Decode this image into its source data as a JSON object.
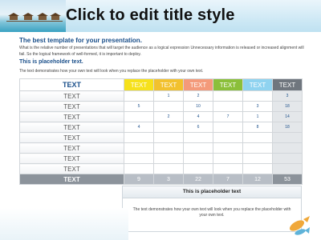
{
  "slide": {
    "title": "Click to edit title style",
    "subtitle": "The best template for your presentation.",
    "intro": "What is the relative number of presentations that will target the audience as a logical expression Unnecessary information is released or increased alignment will fail. So the logical framework of well-formed, it is important to deploy.",
    "placeholder_heading": "This is placeholder text.",
    "placeholder_body": "The text demonstrates how your own text will look when you replace the placeholder with your own text."
  },
  "table": {
    "header_label": "TEXT",
    "columns": [
      "TEXT",
      "TEXT",
      "TEXT",
      "TEXT",
      "TEXT",
      "TEXT"
    ],
    "column_colors": [
      "#f6e11c",
      "#f2c12e",
      "#f49a7a",
      "#8bbf3a",
      "#8fd3f0",
      "#6f767e"
    ],
    "rows": [
      {
        "label": "TEXT",
        "cells": [
          "",
          "1",
          "2",
          "",
          "",
          "3"
        ]
      },
      {
        "label": "TEXT",
        "cells": [
          "5",
          "",
          "10",
          "",
          "3",
          "18"
        ]
      },
      {
        "label": "TEXT",
        "cells": [
          "",
          "2",
          "4",
          "7",
          "1",
          "14"
        ]
      },
      {
        "label": "TEXT",
        "cells": [
          "4",
          "",
          "6",
          "",
          "8",
          "18"
        ]
      },
      {
        "label": "TEXT",
        "cells": [
          "",
          "",
          "",
          "",
          "",
          ""
        ]
      },
      {
        "label": "TEXT",
        "cells": [
          "",
          "",
          "",
          "",
          "",
          ""
        ]
      },
      {
        "label": "TEXT",
        "cells": [
          "",
          "",
          "",
          "",
          "",
          ""
        ]
      },
      {
        "label": "TEXT",
        "cells": [
          "",
          "",
          "",
          "",
          "",
          ""
        ]
      }
    ],
    "footer": {
      "label": "TEXT",
      "cells": [
        "9",
        "3",
        "22",
        "7",
        "12",
        "53"
      ]
    }
  },
  "infobox": {
    "heading": "This is placeholder text",
    "body": "The text demonstrates how your own text will look when you replace the placeholder with your own text."
  }
}
